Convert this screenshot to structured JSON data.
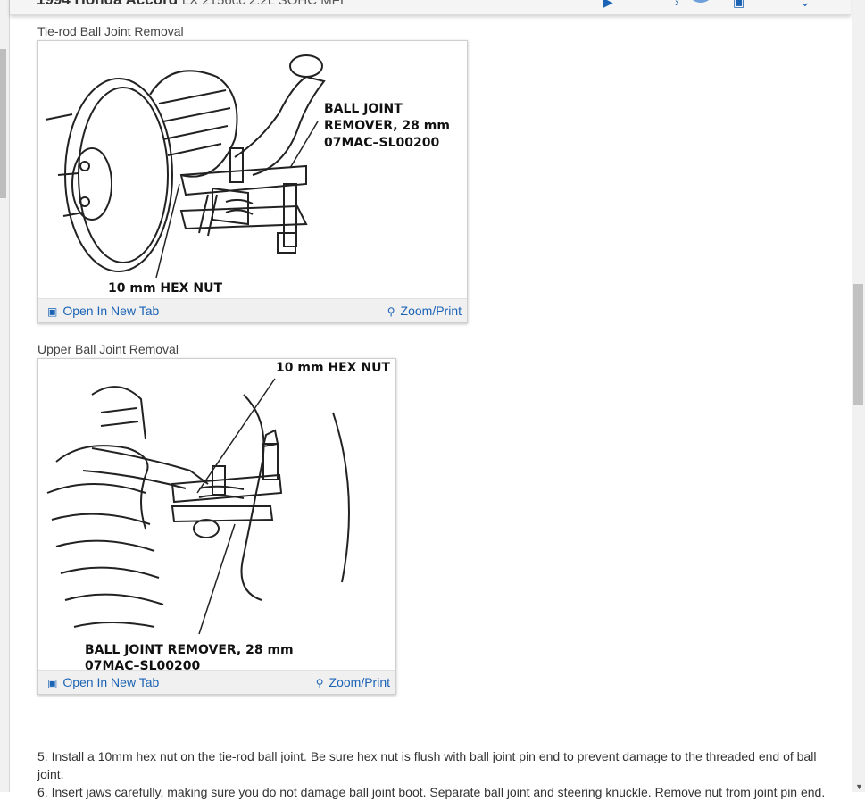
{
  "header": {
    "title": "1994 Honda Accord",
    "subtitle": "LX 2156cc 2.2L SOHC MFI"
  },
  "figures": [
    {
      "caption": "Tie-rod Ball Joint Removal",
      "labels": {
        "tool_line1": "BALL JOINT",
        "tool_line2": "REMOVER, 28 mm",
        "tool_line3": "07MAC–SL00200",
        "nut": "10 mm HEX NUT"
      },
      "open_label": "Open In New Tab",
      "zoom_label": "Zoom/Print"
    },
    {
      "caption": "Upper Ball Joint Removal",
      "labels": {
        "nut": "10 mm HEX NUT",
        "tool_line1": "BALL JOINT REMOVER, 28 mm",
        "tool_line2": "07MAC–SL00200"
      },
      "open_label": "Open In New Tab",
      "zoom_label": "Zoom/Print"
    }
  ],
  "steps": [
    "5. Install a 10mm hex nut on the tie-rod ball joint. Be sure hex nut is flush with ball joint pin end to prevent damage to the threaded end of ball joint.",
    "6. Insert jaws carefully, making sure you do not damage ball joint boot. Separate ball joint and steering knuckle. Remove nut from joint pin end."
  ],
  "icons": {
    "open": "open-in-new-tab-icon",
    "zoom": "magnifier-plus-icon"
  },
  "colors": {
    "link": "#1b63b5",
    "toolbar_bg": "#f0f0f0"
  }
}
